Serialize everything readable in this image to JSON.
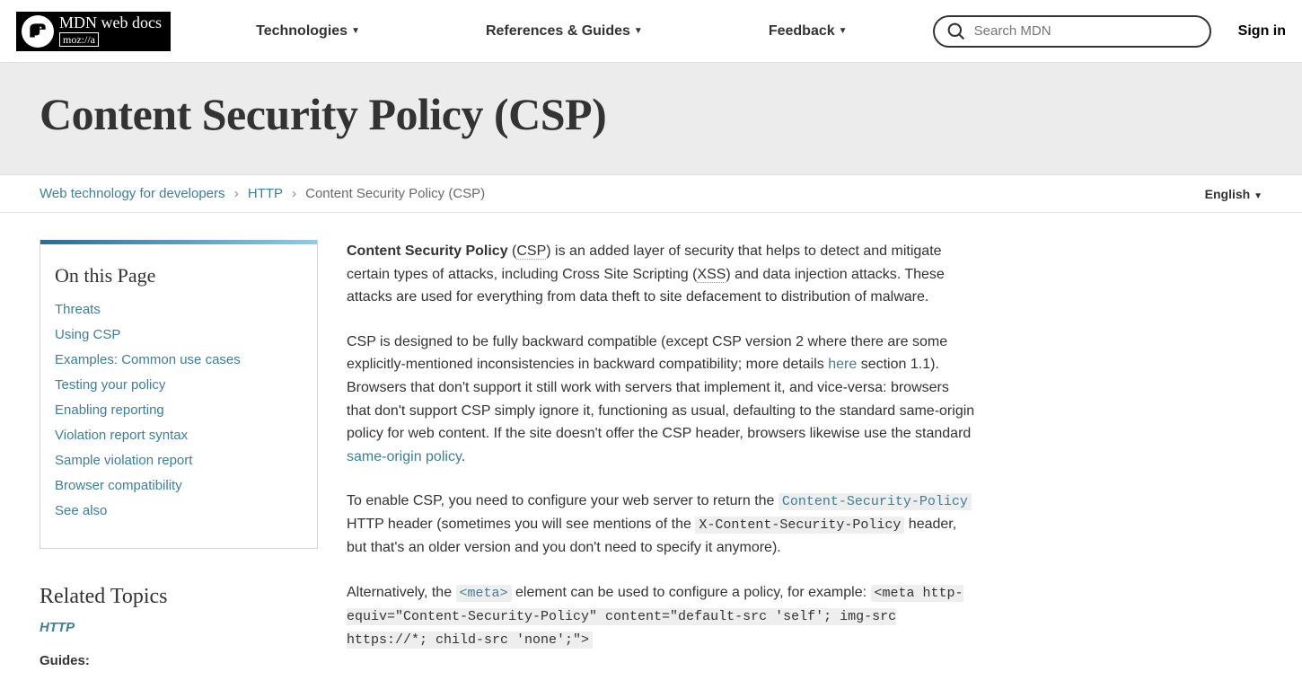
{
  "header": {
    "logo_mdn": "MDN web docs",
    "logo_moz": "moz://a",
    "nav": [
      "Technologies",
      "References & Guides",
      "Feedback"
    ],
    "search_placeholder": "Search MDN",
    "signin": "Sign in"
  },
  "title": "Content Security Policy (CSP)",
  "breadcrumb": {
    "items": [
      "Web technology for developers",
      "HTTP"
    ],
    "current": "Content Security Policy (CSP)",
    "language": "English"
  },
  "toc": {
    "heading": "On this Page",
    "items": [
      "Threats",
      "Using CSP",
      "Examples: Common use cases",
      "Testing your policy",
      "Enabling reporting",
      "Violation report syntax",
      "Sample violation report",
      "Browser compatibility",
      "See also"
    ]
  },
  "related": {
    "heading": "Related Topics",
    "topic": "HTTP",
    "guides": "Guides:"
  },
  "article": {
    "p1_strong": "Content Security Policy",
    "p1_a": " (",
    "p1_abbr1": "CSP",
    "p1_b": ") is an added layer of security that helps to detect and mitigate certain types of attacks, including Cross Site Scripting (",
    "p1_abbr2": "XSS",
    "p1_c": ") and data injection attacks. These attacks are used for everything from data theft to site defacement to distribution of malware.",
    "p2_a": "CSP is designed to be fully backward compatible (except CSP version 2 where there are some explicitly-mentioned inconsistencies in backward compatibility; more details ",
    "p2_link1": "here",
    "p2_b": " section 1.1). Browsers that don't support it still work with servers that implement it, and vice-versa: browsers that don't support CSP simply ignore it, functioning as usual, defaulting to the standard same-origin policy for web content. If the site doesn't offer the CSP header, browsers likewise use the standard ",
    "p2_link2": "same-origin policy",
    "p2_c": ".",
    "p3_a": "To enable CSP, you need to configure your web server to return the ",
    "p3_code1": "Content-Security-Policy",
    "p3_b": " HTTP header (sometimes you will see mentions of the ",
    "p3_code2": "X-Content-Security-Policy",
    "p3_c": " header, but that's an older version and you don't need to specify it anymore).",
    "p4_a": "Alternatively, the ",
    "p4_code1": "<meta>",
    "p4_b": " element can be used to configure a policy, for example: ",
    "p4_code2": "<meta http-equiv=\"Content-Security-Policy\" content=\"default-src 'self'; img-src https://*; child-src 'none';\">"
  }
}
